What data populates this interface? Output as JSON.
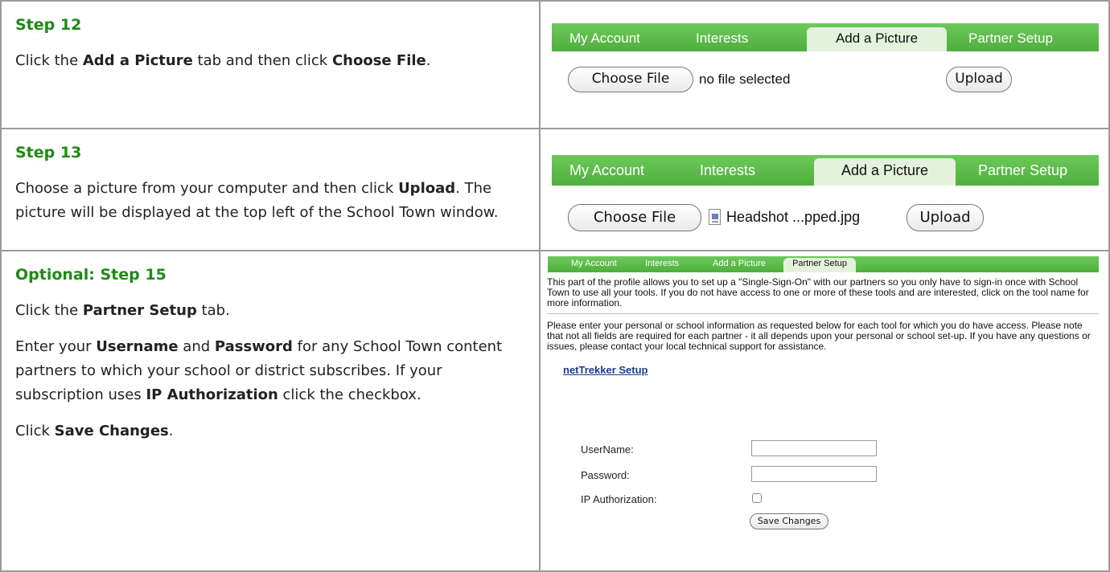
{
  "steps": [
    {
      "title": "Step 12",
      "paragraphs": [
        [
          {
            "text": "Click the ",
            "bold": false
          },
          {
            "text": "Add a Picture",
            "bold": true
          },
          {
            "text": " tab and then click ",
            "bold": false
          },
          {
            "text": "Choose File",
            "bold": true
          },
          {
            "text": ".",
            "bold": false
          }
        ]
      ]
    },
    {
      "title": "Step 13",
      "paragraphs": [
        [
          {
            "text": "Choose a picture from your computer and then click ",
            "bold": false
          },
          {
            "text": "Upload",
            "bold": true
          },
          {
            "text": ". The picture will be displayed at the top left of the School Town window.",
            "bold": false
          }
        ]
      ]
    },
    {
      "title": "Optional: Step 15",
      "paragraphs": [
        [
          {
            "text": "Click the ",
            "bold": false
          },
          {
            "text": "Partner Setup",
            "bold": true
          },
          {
            "text": " tab.",
            "bold": false
          }
        ],
        [
          {
            "text": "Enter your ",
            "bold": false
          },
          {
            "text": "Username",
            "bold": true
          },
          {
            "text": " and ",
            "bold": false
          },
          {
            "text": "Password",
            "bold": true
          },
          {
            "text": " for any School Town content partners to which your school or district subscribes. If your subscription uses ",
            "bold": false
          },
          {
            "text": "IP Authorization",
            "bold": true
          },
          {
            "text": " click the checkbox.",
            "bold": false
          }
        ],
        [
          {
            "text": "Click ",
            "bold": false
          },
          {
            "text": "Save Changes",
            "bold": true
          },
          {
            "text": ".",
            "bold": false
          }
        ]
      ]
    }
  ],
  "tabs": {
    "my_account": "My Account",
    "interests": "Interests",
    "add_picture": "Add a Picture",
    "partner_setup": "Partner Setup"
  },
  "upload": {
    "choose_file": "Choose File",
    "no_file": "no file selected",
    "upload": "Upload",
    "file_name": "Headshot ...pped.jpg"
  },
  "partner": {
    "intro": "This part of the profile allows you to set up a \"Single-Sign-On\" with our partners so you only have to sign-in once with School Town to use all your tools. If you do not have access to one or more of these tools and are interested, click on the tool name for more information.",
    "instructions": "Please enter your personal or school information as requested below for each tool for which you do have access. Please note that not all fields are required for each partner - it all depends upon your personal or school set-up. If you have any questions or issues, please contact your local technical support for assistance.",
    "link": "netTrekker Setup",
    "username_label": "UserName:",
    "password_label": "Password:",
    "ip_label": "IP Authorization:",
    "save": "Save Changes"
  },
  "colors": {
    "heading_green": "#1e8a14",
    "tab_green": "#5dbb4a",
    "active_tab": "#e3f2dc",
    "link_blue": "#1b3c8f"
  }
}
